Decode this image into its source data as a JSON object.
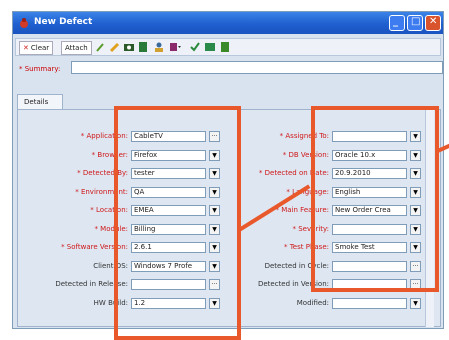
{
  "window": {
    "title": "New Defect"
  },
  "toolbar": {
    "clear_label": "Clear",
    "attach_label": "Attach"
  },
  "summary": {
    "label": "* Summary:",
    "value": ""
  },
  "tabs": [
    {
      "label": "Details"
    }
  ],
  "left_fields": [
    {
      "label": "* Application:",
      "value": "CableTV",
      "control": "ellipsis"
    },
    {
      "label": "* Browser:",
      "value": "Firefox",
      "control": "dropdown"
    },
    {
      "label": "* Detected By:",
      "value": "tester",
      "control": "dropdown"
    },
    {
      "label": "* Environment:",
      "value": "QA",
      "control": "dropdown"
    },
    {
      "label": "* Location:",
      "value": "EMEA",
      "control": "dropdown"
    },
    {
      "label": "* Module:",
      "value": "Billing",
      "control": "dropdown"
    },
    {
      "label": "* Software Version:",
      "value": "2.6.1",
      "control": "dropdown"
    },
    {
      "label": "Client OS:",
      "value": "Windows 7 Profe",
      "control": "dropdown"
    },
    {
      "label": "Detected in Release:",
      "value": "",
      "control": "ellipsis"
    },
    {
      "label": "HW Build:",
      "value": "1.2",
      "control": "dropdown"
    }
  ],
  "right_fields": [
    {
      "label": "* Assigned To:",
      "value": "",
      "control": "dropdown"
    },
    {
      "label": "* DB Version:",
      "value": "Oracle 10.x",
      "control": "dropdown"
    },
    {
      "label": "* Detected on Date:",
      "value": "20.9.2010",
      "control": "dropdown"
    },
    {
      "label": "* Language:",
      "value": "English",
      "control": "dropdown"
    },
    {
      "label": "* Main Feature:",
      "value": "New Order Crea",
      "control": "dropdown"
    },
    {
      "label": "* Severity:",
      "value": "",
      "control": "dropdown"
    },
    {
      "label": "* Test Phase:",
      "value": "Smoke Test",
      "control": "dropdown"
    },
    {
      "label": "Detected in Cycle:",
      "value": "",
      "control": "ellipsis"
    },
    {
      "label": "Detected in Version:",
      "value": "",
      "control": "ellipsis"
    },
    {
      "label": "Modified:",
      "value": "",
      "control": "dropdown"
    }
  ],
  "colors": {
    "highlight": "#e8582a",
    "required_label": "#d01818",
    "titlebar": "#1f5fcf"
  }
}
